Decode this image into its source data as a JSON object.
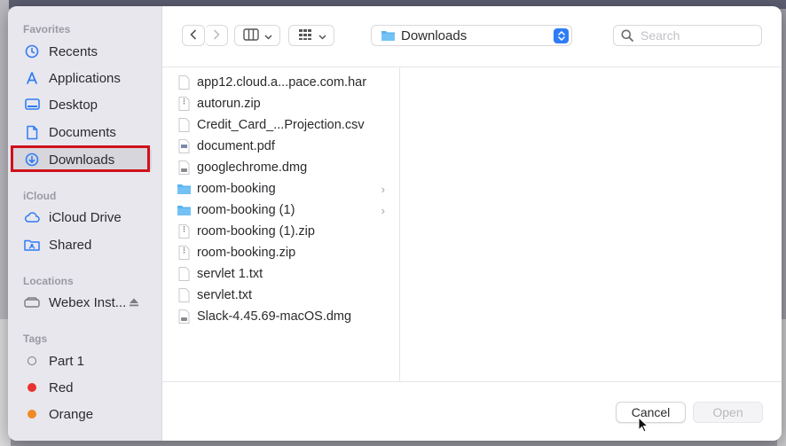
{
  "sidebar": {
    "favorites_title": "Favorites",
    "favorites": [
      {
        "label": "Recents",
        "icon": "clock-icon"
      },
      {
        "label": "Applications",
        "icon": "applications-icon"
      },
      {
        "label": "Desktop",
        "icon": "desktop-icon"
      },
      {
        "label": "Documents",
        "icon": "document-icon"
      },
      {
        "label": "Downloads",
        "icon": "download-icon",
        "selected": true
      }
    ],
    "icloud_title": "iCloud",
    "icloud": [
      {
        "label": "iCloud Drive",
        "icon": "cloud-icon"
      },
      {
        "label": "Shared",
        "icon": "shared-folder-icon"
      }
    ],
    "locations_title": "Locations",
    "locations": [
      {
        "label": "Webex Inst...",
        "icon": "drive-icon"
      }
    ],
    "tags_title": "Tags",
    "tags": [
      {
        "label": "Part 1",
        "color": "none"
      },
      {
        "label": "Red",
        "color": "#e8322f"
      },
      {
        "label": "Orange",
        "color": "#f08a24"
      }
    ]
  },
  "toolbar": {
    "location": "Downloads",
    "search_placeholder": "Search"
  },
  "files": [
    {
      "name": "app12.cloud.a...pace.com.har",
      "type": "file"
    },
    {
      "name": "autorun.zip",
      "type": "zip"
    },
    {
      "name": "Credit_Card_...Projection.csv",
      "type": "file"
    },
    {
      "name": "document.pdf",
      "type": "pdf"
    },
    {
      "name": "googlechrome.dmg",
      "type": "dmg"
    },
    {
      "name": "room-booking",
      "type": "folder"
    },
    {
      "name": "room-booking (1)",
      "type": "folder"
    },
    {
      "name": "room-booking (1).zip",
      "type": "zip"
    },
    {
      "name": "room-booking.zip",
      "type": "zip"
    },
    {
      "name": "servlet 1.txt",
      "type": "file"
    },
    {
      "name": "servlet.txt",
      "type": "file"
    },
    {
      "name": "Slack-4.45.69-macOS.dmg",
      "type": "dmg"
    }
  ],
  "footer": {
    "cancel_label": "Cancel",
    "open_label": "Open"
  },
  "colors": {
    "accent": "#2f7cf6",
    "highlight": "#d0101a",
    "folder": "#5bb3f0"
  }
}
